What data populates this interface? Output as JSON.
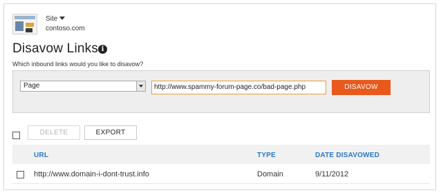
{
  "site": {
    "label": "Site",
    "domain": "contoso.com"
  },
  "page": {
    "title": "Disavow Links",
    "info_glyph": "i",
    "subtitle": "Which inbound links would you like to disavow?"
  },
  "form": {
    "select_value": "Page",
    "url_value": "http://www.spammy-forum-page.co/bad-page.php",
    "disavow_label": "DISAVOW"
  },
  "toolbar": {
    "delete_label": "DELETE",
    "export_label": "EXPORT"
  },
  "table": {
    "columns": [
      "URL",
      "TYPE",
      "DATE DISAVOWED"
    ],
    "rows": [
      {
        "url": "http://www.domain-i-dont-trust.info",
        "type": "Domain",
        "date": "9/11/2012"
      }
    ]
  },
  "colors": {
    "accent_orange": "#e8591a",
    "header_blue": "#2a78c6"
  }
}
